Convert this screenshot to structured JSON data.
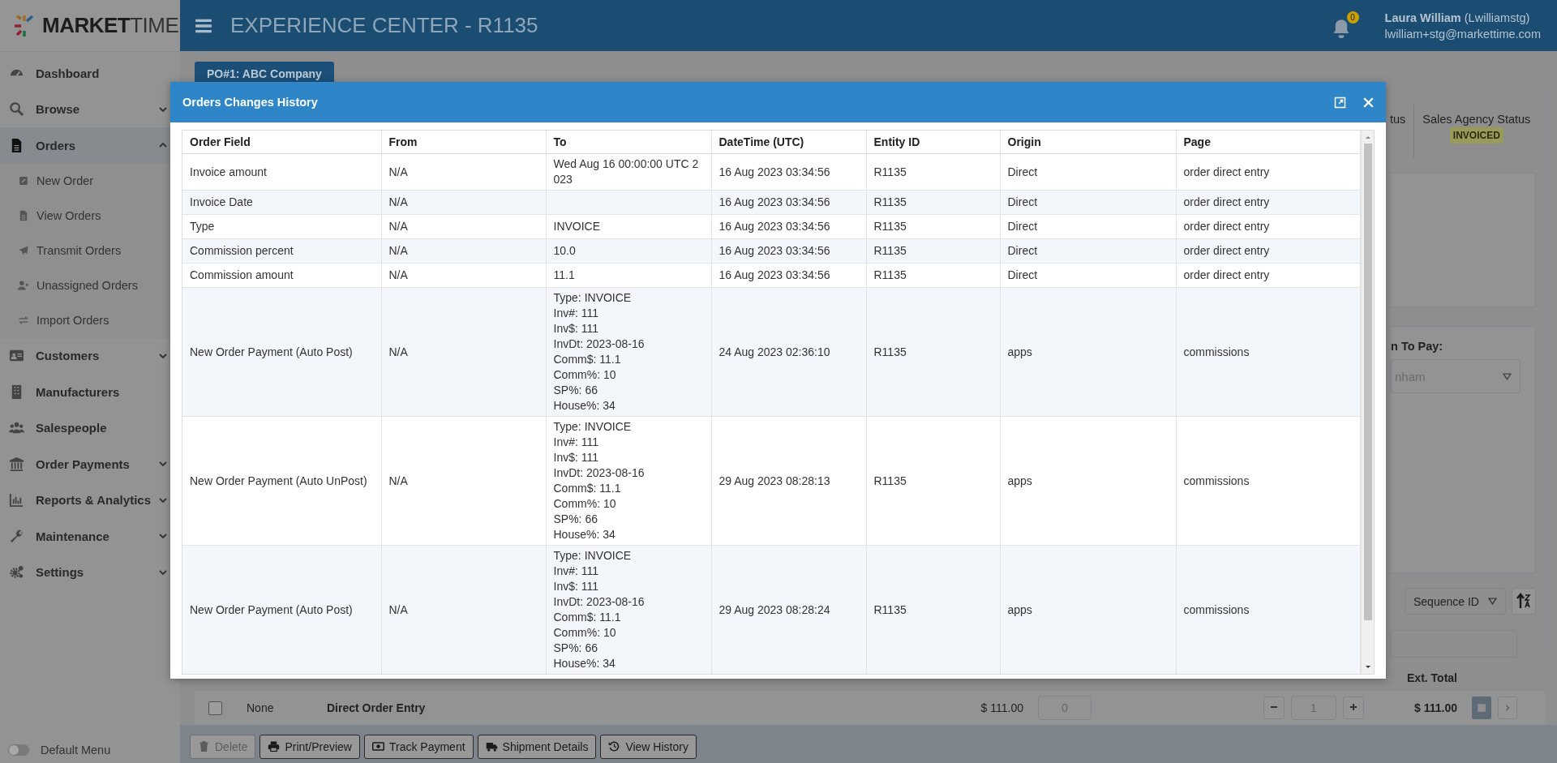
{
  "app": {
    "logo": {
      "bold": "MARKET",
      "light": "TIME"
    },
    "title": "EXPERIENCE CENTER - R1135",
    "notifications": "0",
    "user": {
      "name": "Laura William",
      "username": "(Lwilliamstg)",
      "email": "lwilliam+stg@markettime.com"
    }
  },
  "sidebar": {
    "items": [
      {
        "label": "Dashboard",
        "selected": false
      },
      {
        "label": "Browse",
        "expanded": false,
        "selected": false
      },
      {
        "label": "Orders",
        "expanded": true,
        "selected": true,
        "children": [
          {
            "label": "New Order"
          },
          {
            "label": "View Orders"
          },
          {
            "label": "Transmit Orders"
          },
          {
            "label": "Unassigned Orders"
          },
          {
            "label": "Import Orders"
          }
        ]
      },
      {
        "label": "Customers",
        "expanded": false,
        "selected": false
      },
      {
        "label": "Manufacturers",
        "selected": false
      },
      {
        "label": "Salespeople",
        "selected": false
      },
      {
        "label": "Order Payments",
        "expanded": false,
        "selected": false
      },
      {
        "label": "Reports & Analytics",
        "expanded": false,
        "selected": false
      },
      {
        "label": "Maintenance",
        "expanded": false,
        "selected": false
      },
      {
        "label": "Settings",
        "expanded": false,
        "selected": false
      }
    ],
    "default_menu": {
      "label": "Default Menu",
      "on": false
    }
  },
  "order": {
    "tab": "PO#1: ABC Company",
    "status_partial": "tus",
    "sales_agency_status": {
      "label": "Sales Agency Status",
      "value": "INVOICED"
    },
    "pay_label": "n To Pay:",
    "pay_value": "nham",
    "sort": {
      "value": "Sequence ID"
    },
    "table": {
      "header": "Ext. Total",
      "rows": [
        {
          "checked": false,
          "column_1": "None",
          "column_2": "Direct Order Entry",
          "column_3": "$ 111.00",
          "column_4": "0",
          "quantity": "1",
          "total": "$ 111.00"
        }
      ]
    }
  },
  "actions": [
    {
      "label": "Delete",
      "disabled": true
    },
    {
      "label": "Print/Preview",
      "disabled": false
    },
    {
      "label": "Track Payment",
      "disabled": false
    },
    {
      "label": "Shipment Details",
      "disabled": false
    },
    {
      "label": "View History",
      "disabled": false
    }
  ],
  "modal": {
    "title": "Orders Changes History",
    "columns": [
      "Order Field",
      "From",
      "To",
      "DateTime (UTC)",
      "Entity ID",
      "Origin",
      "Page"
    ],
    "rows": [
      {
        "order_field": "Invoice amount",
        "from": "N/A",
        "to": "Wed Aug 16 00:00:00 UTC 2023",
        "datetime": "16 Aug 2023 03:34:56",
        "entity_id": "R1135",
        "origin": "Direct",
        "page": "order direct entry"
      },
      {
        "order_field": "Invoice Date",
        "from": "N/A",
        "to": "",
        "datetime": "16 Aug 2023 03:34:56",
        "entity_id": "R1135",
        "origin": "Direct",
        "page": "order direct entry"
      },
      {
        "order_field": "Type",
        "from": "N/A",
        "to": "INVOICE",
        "datetime": "16 Aug 2023 03:34:56",
        "entity_id": "R1135",
        "origin": "Direct",
        "page": "order direct entry"
      },
      {
        "order_field": "Commission percent",
        "from": "N/A",
        "to": "10.0",
        "datetime": "16 Aug 2023 03:34:56",
        "entity_id": "R1135",
        "origin": "Direct",
        "page": "order direct entry"
      },
      {
        "order_field": "Commission amount",
        "from": "N/A",
        "to": "11.1",
        "datetime": "16 Aug 2023 03:34:56",
        "entity_id": "R1135",
        "origin": "Direct",
        "page": "order direct entry"
      },
      {
        "order_field": "New Order Payment (Auto Post)",
        "from": "N/A",
        "to": "Type: INVOICE\nInv#: 111\nInv$: 111\nInvDt: 2023-08-16\nComm$: 11.1\nComm%: 10\nSP%: 66\nHouse%: 34",
        "datetime": "24 Aug 2023 02:36:10",
        "entity_id": "R1135",
        "origin": "apps",
        "page": "commissions"
      },
      {
        "order_field": "New Order Payment (Auto UnPost)",
        "from": "N/A",
        "to": "Type: INVOICE\nInv#: 111\nInv$: 111\nInvDt: 2023-08-16\nComm$: 11.1\nComm%: 10\nSP%: 66\nHouse%: 34",
        "datetime": "29 Aug 2023 08:28:13",
        "entity_id": "R1135",
        "origin": "apps",
        "page": "commissions"
      },
      {
        "order_field": "New Order Payment (Auto Post)",
        "from": "N/A",
        "to": "Type: INVOICE\nInv#: 111\nInv$: 111\nInvDt: 2023-08-16\nComm$: 11.1\nComm%: 10\nSP%: 66\nHouse%: 34",
        "datetime": "29 Aug 2023 08:28:24",
        "entity_id": "R1135",
        "origin": "apps",
        "page": "commissions"
      }
    ]
  }
}
